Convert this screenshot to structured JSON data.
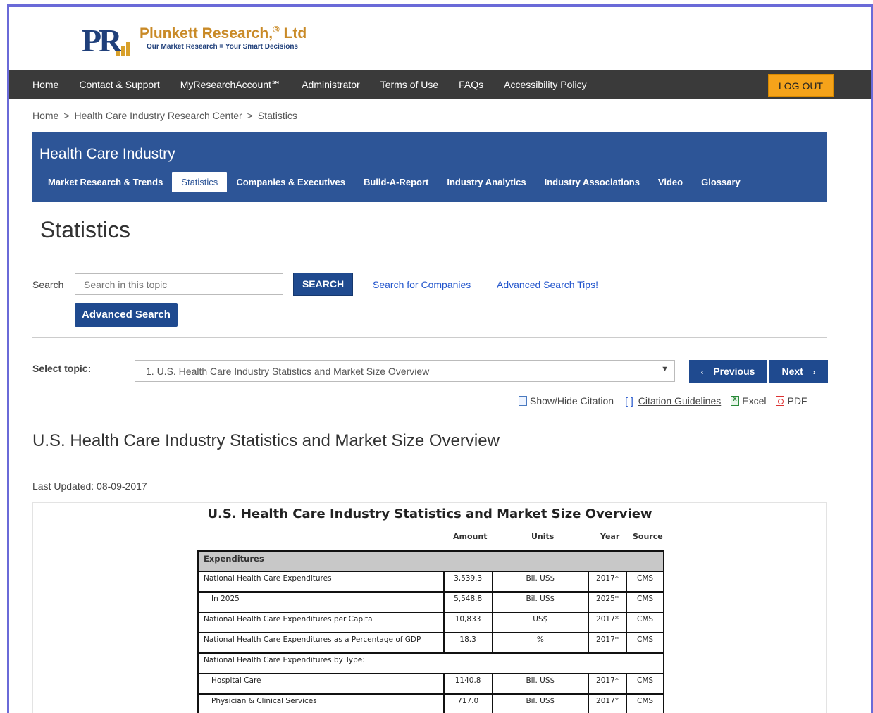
{
  "brand": {
    "logo_letters": "PR",
    "name": "Plunkett Research,",
    "registered": "®",
    "suffix": "Ltd",
    "tagline": "Our Market Research = Your Smart Decisions",
    "colors": {
      "gold": "#c98a27",
      "navy": "#1f3f7a"
    }
  },
  "topnav": {
    "items": [
      "Home",
      "Contact & Support",
      "MyResearchAccount℠",
      "Administrator",
      "Terms of Use",
      "FAQs",
      "Accessibility Policy"
    ],
    "logout_label": "LOG OUT"
  },
  "breadcrumb": {
    "items": [
      "Home",
      "Health Care Industry Research Center",
      "Statistics"
    ],
    "separator": ">"
  },
  "industry": {
    "title": "Health Care Industry",
    "tabs": [
      "Market Research & Trends",
      "Statistics",
      "Companies & Executives",
      "Build-A-Report",
      "Industry Analytics",
      "Industry Associations",
      "Video",
      "Glossary"
    ],
    "active_tab": "Statistics"
  },
  "page": {
    "title": "Statistics"
  },
  "search": {
    "label": "Search",
    "placeholder": "Search in this topic",
    "button_label": "SEARCH",
    "companies_link": "Search for Companies",
    "tips_link": "Advanced Search Tips!",
    "advanced_label": "Advanced Search"
  },
  "topic": {
    "label": "Select topic:",
    "selected": "1. U.S. Health Care Industry Statistics and Market Size Overview",
    "prev_label": "Previous",
    "next_label": "Next"
  },
  "toolbar": {
    "show_hide": "Show/Hide Citation",
    "brackets": "[ ]",
    "guidelines": "Citation Guidelines",
    "excel": "Excel",
    "pdf": "PDF"
  },
  "section": {
    "title": "U.S. Health Care Industry Statistics and Market Size Overview",
    "last_updated": "Last Updated: 08-09-2017"
  },
  "stats_table": {
    "title": "U.S. Health Care Industry Statistics and Market Size Overview",
    "columns": [
      "Amount",
      "Units",
      "Year",
      "Source"
    ],
    "group": "Expenditures",
    "rows": [
      {
        "label": "National Health Care Expenditures",
        "amount": "3,539.3",
        "units": "Bil. US$",
        "year": "2017*",
        "source": "CMS",
        "indent": false
      },
      {
        "label": "In 2025",
        "amount": "5,548.8",
        "units": "Bil. US$",
        "year": "2025*",
        "source": "CMS",
        "indent": true
      },
      {
        "label": "National Health Care Expenditures per Capita",
        "amount": "10,833",
        "units": "US$",
        "year": "2017*",
        "source": "CMS",
        "indent": false
      },
      {
        "label": "National Health Care Expenditures as a Percentage of GDP",
        "amount": "18.3",
        "units": "%",
        "year": "2017*",
        "source": "CMS",
        "indent": false
      },
      {
        "label": "National Health Care Expenditures by Type:",
        "amount": "",
        "units": "",
        "year": "",
        "source": "",
        "indent": false,
        "span": true
      },
      {
        "label": "Hospital Care",
        "amount": "1140.8",
        "units": "Bil. US$",
        "year": "2017*",
        "source": "CMS",
        "indent": true
      },
      {
        "label": "Physician & Clinical Services",
        "amount": "717.0",
        "units": "Bil. US$",
        "year": "2017*",
        "source": "CMS",
        "indent": true
      }
    ]
  }
}
